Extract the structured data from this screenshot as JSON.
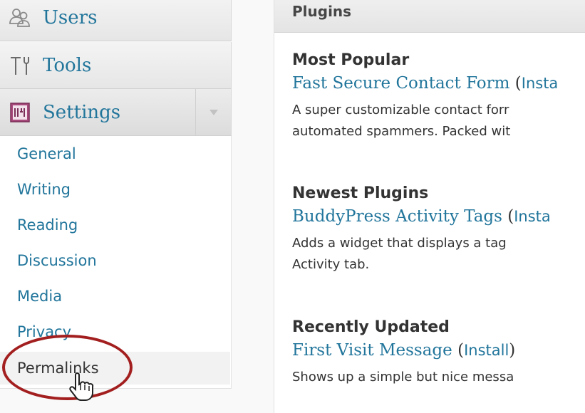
{
  "sidebar": {
    "menu": [
      {
        "label": "Users",
        "icon": "users-icon"
      },
      {
        "label": "Tools",
        "icon": "tools-icon"
      },
      {
        "label": "Settings",
        "icon": "settings-icon"
      }
    ],
    "settings_submenu": [
      "General",
      "Writing",
      "Reading",
      "Discussion",
      "Media",
      "Privacy",
      "Permalinks"
    ],
    "current_item": "Permalinks"
  },
  "plugins": {
    "header": "Plugins",
    "sections": [
      {
        "heading": "Most Popular",
        "name": "Fast Secure Contact Form",
        "action": "Insta",
        "desc_lines": [
          "A super customizable contact forr",
          "automated spammers. Packed wit"
        ]
      },
      {
        "heading": "Newest Plugins",
        "name": "BuddyPress Activity Tags",
        "action": "Insta",
        "desc_lines": [
          "Adds a widget that displays a tag",
          "Activity tab."
        ]
      },
      {
        "heading": "Recently Updated",
        "name": "First Visit Message",
        "action": "Install",
        "desc_lines": [
          "Shows up a simple but nice messa"
        ]
      }
    ]
  },
  "colors": {
    "link": "#21759b",
    "highlight": "#a31f1f",
    "text": "#333333"
  }
}
